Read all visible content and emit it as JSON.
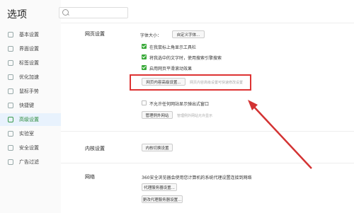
{
  "window": {
    "title": "选项"
  },
  "sidebar": {
    "items": [
      {
        "label": "基本设置",
        "icon": "settings-icon"
      },
      {
        "label": "界面设置",
        "icon": "window-icon"
      },
      {
        "label": "标签设置",
        "icon": "tab-icon"
      },
      {
        "label": "优化加速",
        "icon": "rocket-icon"
      },
      {
        "label": "鼠标手势",
        "icon": "mouse-icon"
      },
      {
        "label": "快捷键",
        "icon": "keyboard-icon"
      },
      {
        "label": "高级设置",
        "icon": "advanced-icon",
        "active": true
      },
      {
        "label": "实验室",
        "icon": "flask-icon"
      },
      {
        "label": "安全设置",
        "icon": "shield-icon"
      },
      {
        "label": "广告过滤",
        "icon": "ad-block-icon"
      }
    ]
  },
  "web": {
    "section": "网页设置",
    "font_size_label": "字体大小：",
    "custom_font_button": "自定义字体...",
    "options": [
      {
        "label": "在我鼠标上角显示工具栏",
        "checked": true
      },
      {
        "label": "将我选中的文字时，使用搜索引擎搜索",
        "checked": true
      },
      {
        "label": "启用网页平滑滚动效果",
        "checked": true
      }
    ],
    "content_settings_button": "网页内容高级设置...",
    "content_settings_hint": "网页内容高级设置可快速修改设置",
    "popup_option": {
      "label": "不允许任何网站显示弹出式窗口",
      "checked": false
    },
    "manage_button": "管理例外网站",
    "manage_hint": "管理例外网站允许显示"
  },
  "kernel": {
    "section": "内核设置",
    "button": "内核切换设置"
  },
  "network": {
    "section": "网络",
    "description": "360安全浏览器会使用您计算机的系统代理设置连接到网络",
    "proxy_button": "代理服务器设置...",
    "change_proxy_button": "更改代理服务器设置..."
  },
  "colors": {
    "accent": "#3aaa3a",
    "highlight": "#d33333",
    "active_bg": "#e8f2fd"
  }
}
